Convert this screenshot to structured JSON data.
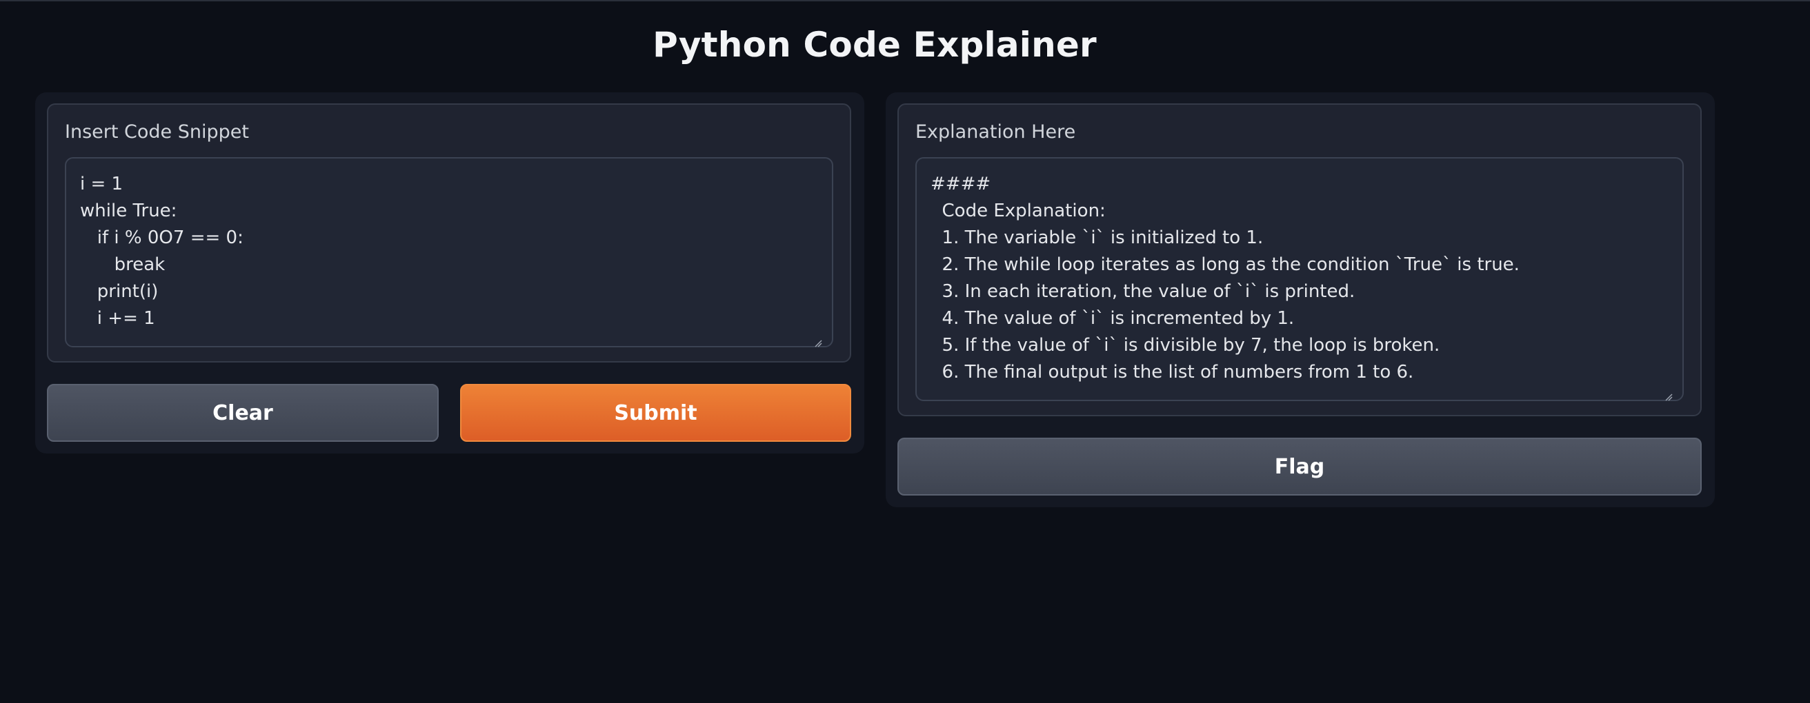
{
  "app": {
    "title": "Python Code Explainer"
  },
  "input": {
    "label": "Insert Code Snippet",
    "value": "i = 1\nwhile True:\n   if i % 0O7 == 0:\n      break\n   print(i)\n   i += 1"
  },
  "output": {
    "label": "Explanation Here",
    "value": "####\n  Code Explanation:\n  1. The variable `i` is initialized to 1.\n  2. The while loop iterates as long as the condition `True` is true.\n  3. In each iteration, the value of `i` is printed.\n  4. The value of `i` is incremented by 1.\n  5. If the value of `i` is divisible by 7, the loop is broken.\n  6. The final output is the list of numbers from 1 to 6."
  },
  "buttons": {
    "clear": "Clear",
    "submit": "Submit",
    "flag": "Flag"
  },
  "icons": {
    "resize": "resize-grip-icon"
  },
  "colors": {
    "background": "#0c0f17",
    "panel": "#1f2330",
    "primary": "#e8702f",
    "secondary": "#4a505d"
  }
}
